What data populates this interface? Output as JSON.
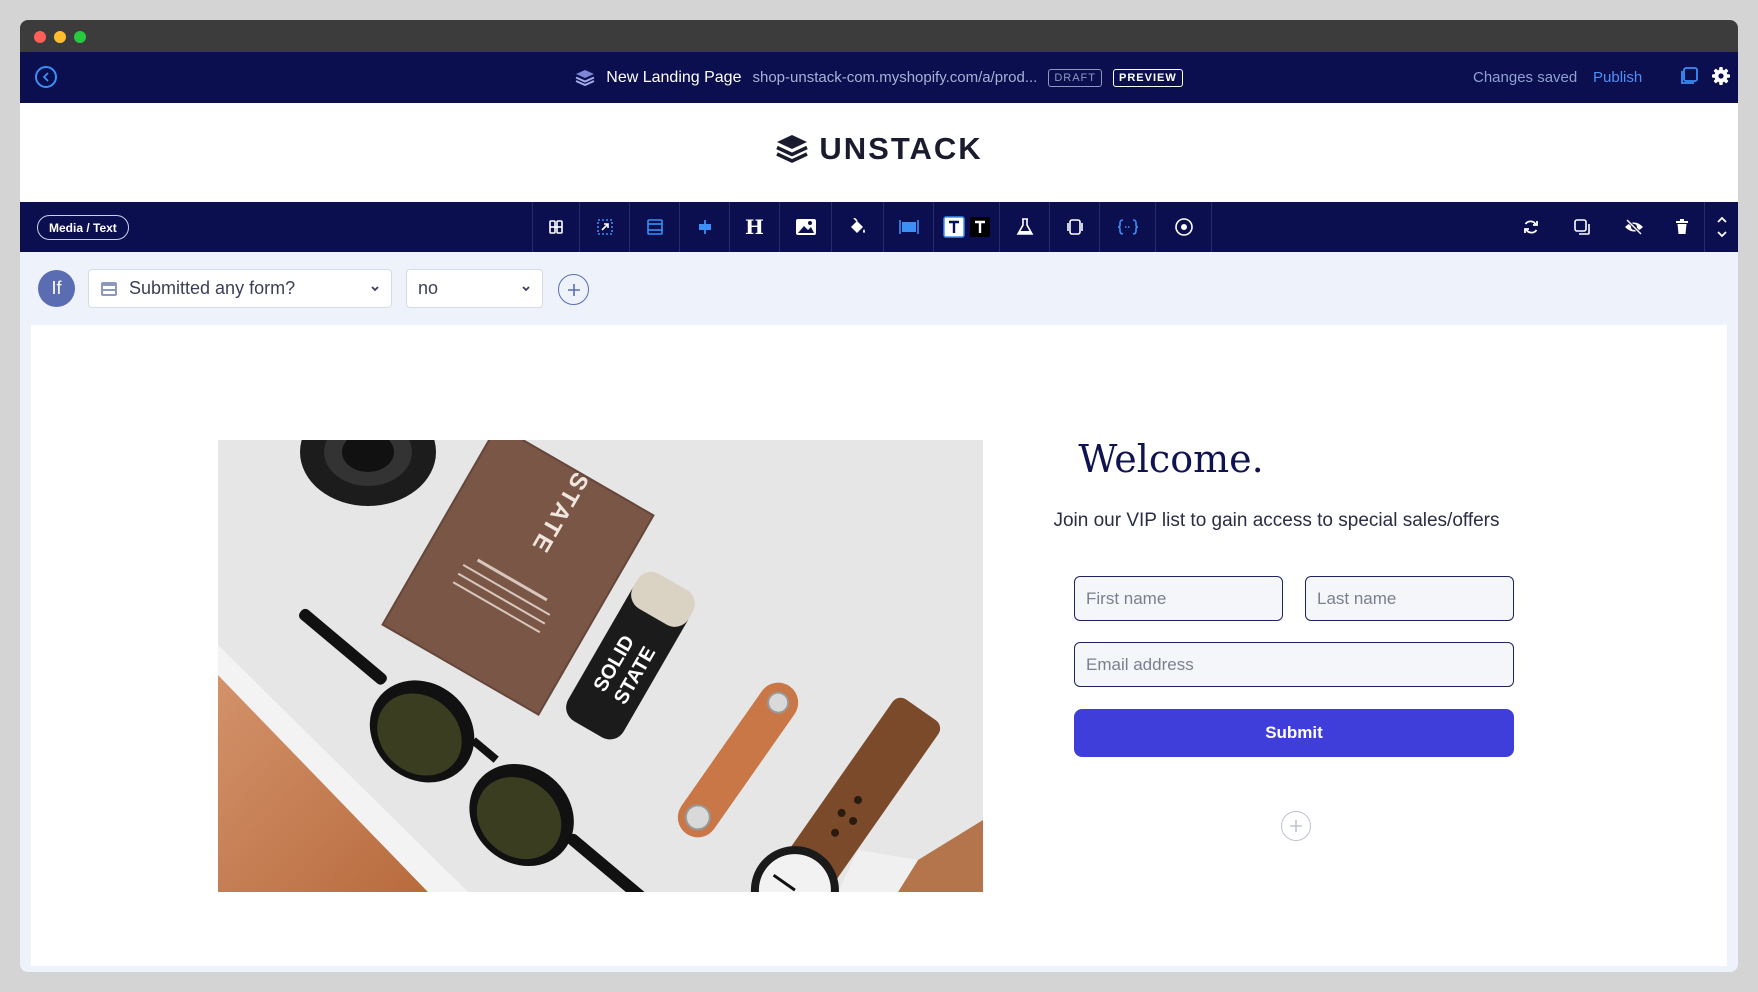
{
  "app_bar": {
    "page_title": "New Landing Page",
    "page_url": "shop-unstack-com.myshopify.com/a/prod...",
    "draft_badge": "DRAFT",
    "preview_badge": "PREVIEW",
    "save_status": "Changes saved",
    "publish_label": "Publish"
  },
  "header": {
    "logo_text": "UNSTACK"
  },
  "toolbar": {
    "section_label": "Media / Text",
    "tools": [
      "layout-icon",
      "select-area-icon",
      "section-spacing-icon",
      "align-icon",
      "heading-icon",
      "image-icon",
      "fill-icon",
      "width-icon",
      "text-style-icon",
      "experiment-icon",
      "device-icon",
      "code-icon",
      "target-icon"
    ],
    "right_tools": [
      "refresh-icon",
      "duplicate-icon",
      "hide-icon",
      "delete-icon",
      "reorder-icon"
    ]
  },
  "condition": {
    "if_label": "If",
    "condition_value": "Submitted any form?",
    "value_option": "no"
  },
  "content": {
    "title": "Welcome.",
    "subtitle": "Join our VIP list to gain access to special sales/offers",
    "first_name_placeholder": "First name",
    "last_name_placeholder": "Last name",
    "email_placeholder": "Email address",
    "submit_label": "Submit",
    "image_text": {
      "box_brand": "STATE",
      "tin_line1": "SOLID",
      "tin_line2": "STATE"
    }
  },
  "colors": {
    "navy": "#0b0f4f",
    "accent_blue": "#3b8ff5",
    "submit": "#3f3edb",
    "background": "#eef2fb"
  }
}
